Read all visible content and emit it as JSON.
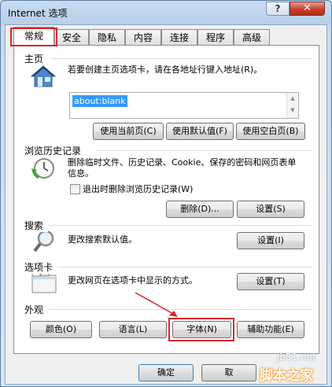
{
  "window": {
    "title": "Internet 选项",
    "help_label": "?",
    "close_label": "✕"
  },
  "tabs": [
    {
      "label": "常规"
    },
    {
      "label": "安全"
    },
    {
      "label": "隐私"
    },
    {
      "label": "内容"
    },
    {
      "label": "连接"
    },
    {
      "label": "程序"
    },
    {
      "label": "高级"
    }
  ],
  "home": {
    "title": "主页",
    "description": "若要创建主页选项卡，请在各地址行键入地址(R)。",
    "url_value": "about:blank",
    "buttons": {
      "use_current": "使用当前页(C)",
      "use_default": "使用默认值(F)",
      "use_blank": "使用空白页(B)"
    }
  },
  "history": {
    "title": "浏览历史记录",
    "description": "删除临时文件、历史记录、Cookie、保存的密码和网页表单信息。",
    "checkbox_label": "退出时删除浏览历史记录(W)",
    "buttons": {
      "delete": "删除(D)...",
      "settings": "设置(S)"
    }
  },
  "search": {
    "title": "搜索",
    "description": "更改搜索默认值。",
    "settings": "设置(I)"
  },
  "tabs_section": {
    "title": "选项卡",
    "description": "更改网页在选项卡中显示的方式。",
    "settings": "设置(T)"
  },
  "appearance": {
    "title": "外观",
    "buttons": {
      "colors": "颜色(O)",
      "languages": "语言(L)",
      "fonts": "字体(N)",
      "accessibility": "辅助功能(E)"
    }
  },
  "footer": {
    "ok": "确定",
    "cancel": "取"
  },
  "watermark": {
    "site": "jb51.net",
    "brand": "脚本之家"
  },
  "icons": [
    "house-icon",
    "history-clock-icon",
    "magnifier-search-icon",
    "tabs-window-icon"
  ]
}
